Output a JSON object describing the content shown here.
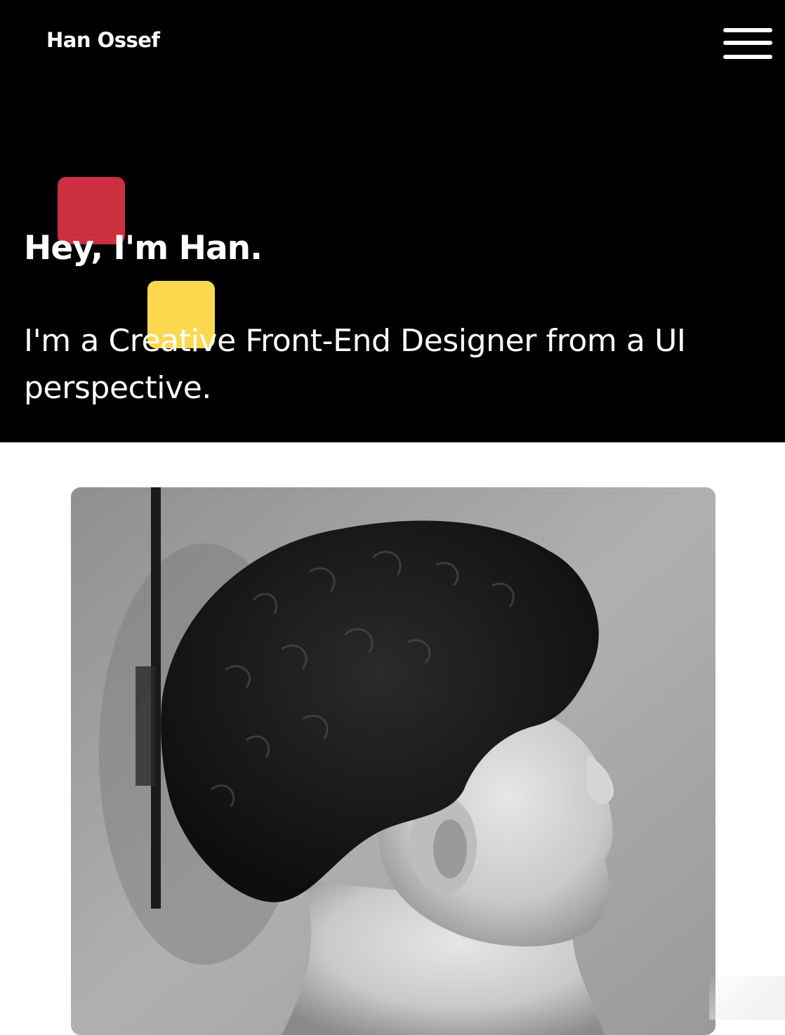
{
  "header": {
    "logo_text": "Han Ossef",
    "menu_icon": "hamburger-menu-icon"
  },
  "hero": {
    "headline": "Hey, I'm Han.",
    "tagline": "I'm a Creative Front-End Designer from a UI perspective."
  },
  "colors": {
    "hero_background": "#000000",
    "hero_text": "#ffffff",
    "accent_red": "#cc2f3f",
    "accent_yellow": "#fbd84e"
  },
  "portrait": {
    "style": "black-and-white profile photo"
  }
}
